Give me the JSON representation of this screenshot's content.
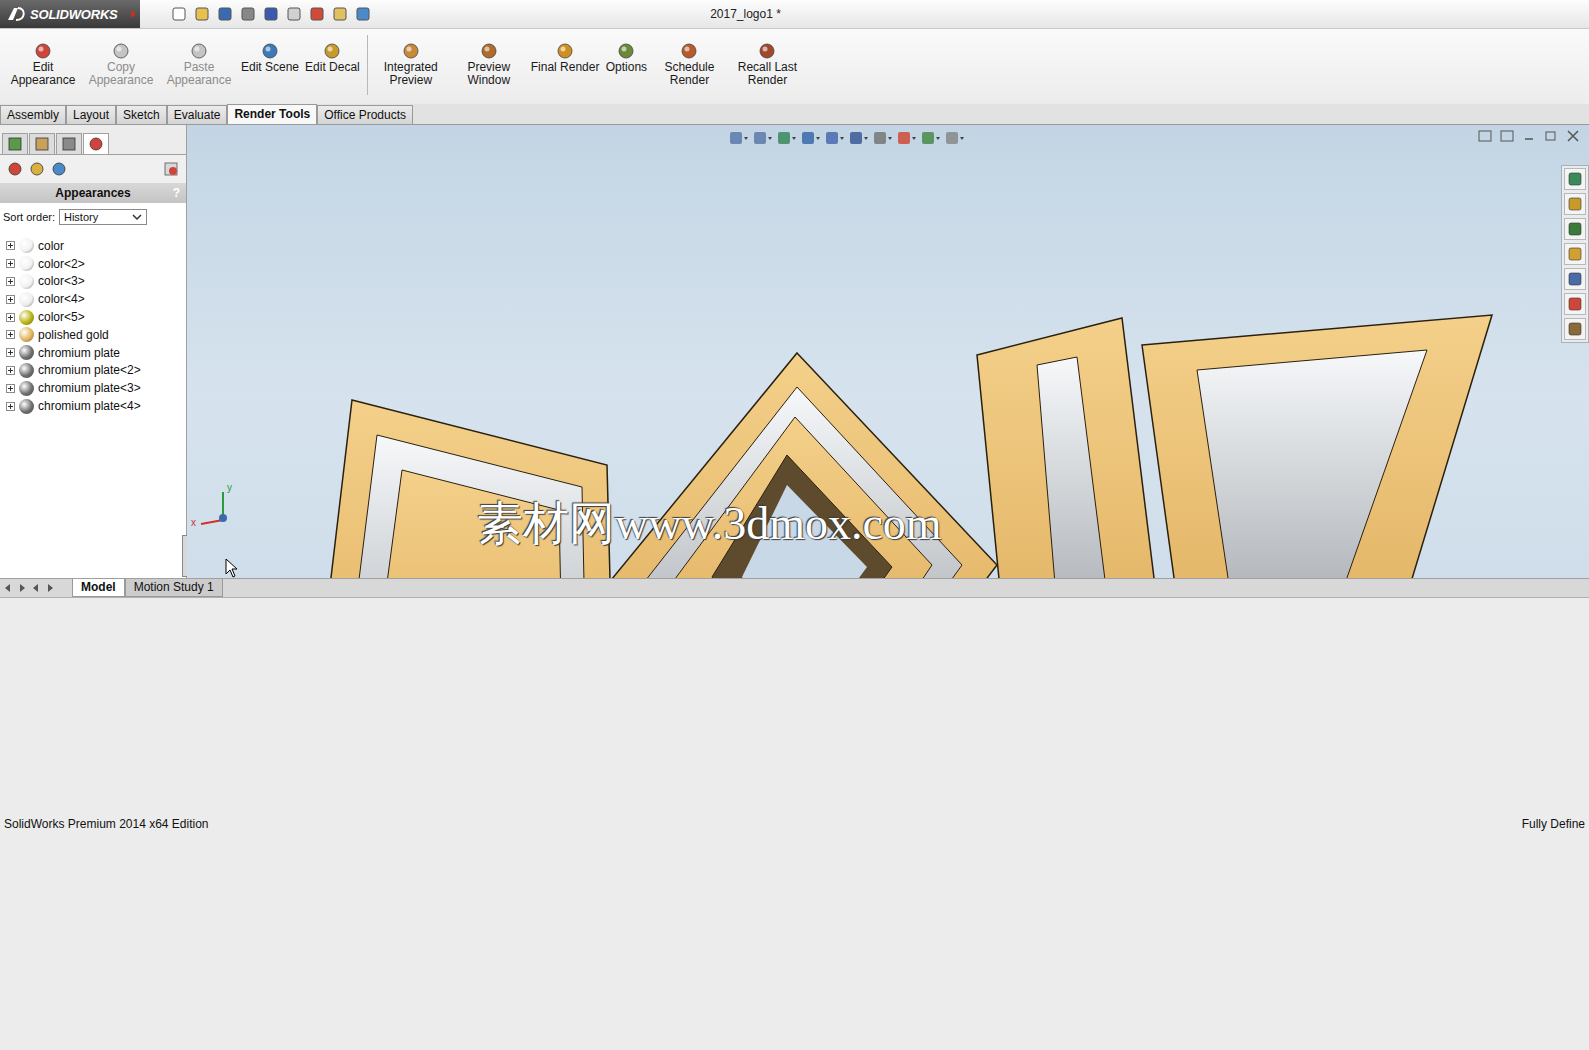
{
  "window": {
    "app": "SOLIDWORKS",
    "title": "2017_logo1 *"
  },
  "ribbon": [
    {
      "label": "Edit Appearance",
      "disabled": false
    },
    {
      "label": "Copy Appearance",
      "disabled": true
    },
    {
      "label": "Paste Appearance",
      "disabled": true
    },
    {
      "label": "Edit Scene",
      "disabled": false
    },
    {
      "label": "Edit Decal",
      "disabled": false
    },
    {
      "label": "Integrated Preview",
      "disabled": false
    },
    {
      "label": "Preview Window",
      "disabled": false
    },
    {
      "label": "Final Render",
      "disabled": false
    },
    {
      "label": "Options",
      "disabled": false
    },
    {
      "label": "Schedule Render",
      "disabled": false
    },
    {
      "label": "Recall Last Render",
      "disabled": false
    }
  ],
  "tabs": [
    {
      "label": "Assembly",
      "selected": false
    },
    {
      "label": "Layout",
      "selected": false
    },
    {
      "label": "Sketch",
      "selected": false
    },
    {
      "label": "Evaluate",
      "selected": false
    },
    {
      "label": "Render Tools",
      "selected": true
    },
    {
      "label": "Office Products",
      "selected": false
    }
  ],
  "panel": {
    "title": "Appearances",
    "help": "?",
    "sort_label": "Sort order:",
    "sort_value": "History",
    "items": [
      {
        "label": "color",
        "color": "#f2f2f2",
        "expanded": false
      },
      {
        "label": "color<2>",
        "color": "#f2f2f2",
        "expanded": false
      },
      {
        "label": "color<3>",
        "color": "#f2f2f2",
        "expanded": false
      },
      {
        "label": "color<4>",
        "color": "#eeeeee",
        "expanded": false
      },
      {
        "label": "color<5>",
        "color": "#b8b410",
        "expanded": false
      },
      {
        "label": "polished gold",
        "color": "#e2b45a",
        "expanded": false
      },
      {
        "label": "chromium plate",
        "color": "#6e6e6e",
        "expanded": false
      },
      {
        "label": "chromium plate<2>",
        "color": "#6e6e6e",
        "expanded": false
      },
      {
        "label": "chromium plate<3>",
        "color": "#6e6e6e",
        "expanded": false
      },
      {
        "label": "chromium plate<4>",
        "color": "#6e6e6e",
        "expanded": false
      }
    ]
  },
  "viewport": {
    "watermark": "素材网www.3dmox.com",
    "triad": {
      "x": "x",
      "y": "y"
    }
  },
  "model_tabs": [
    {
      "label": "Model",
      "selected": true
    },
    {
      "label": "Motion Study 1",
      "selected": false
    }
  ],
  "status_bar": {
    "left": "SolidWorks Premium 2014 x64 Edition",
    "right": "Fully Define"
  }
}
